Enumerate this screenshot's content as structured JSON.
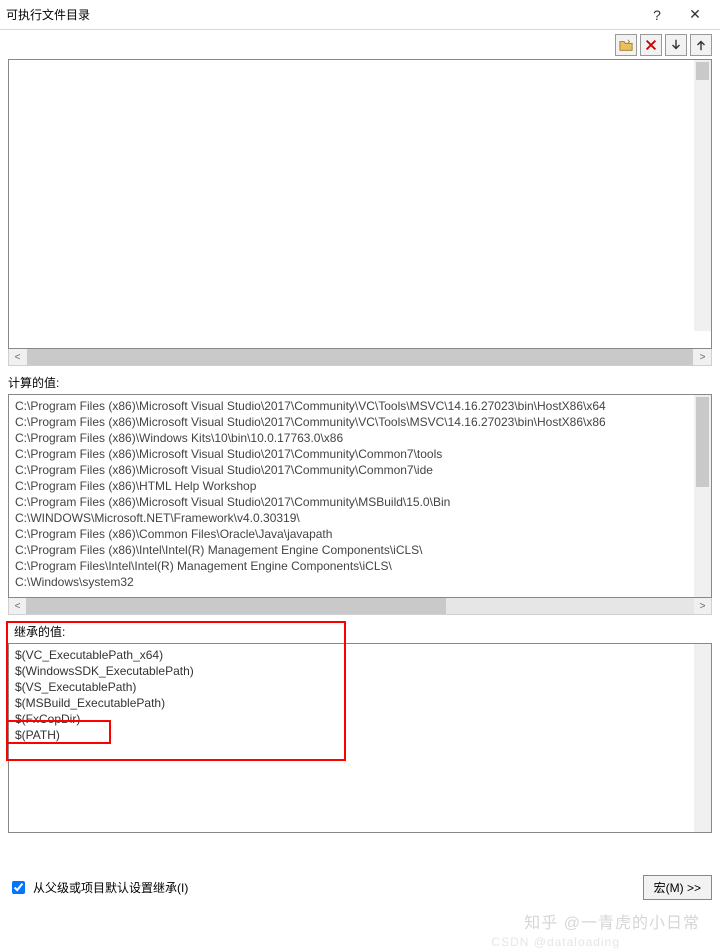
{
  "title": "可执行文件目录",
  "toolbar": {
    "new_folder_icon": "folder",
    "delete_icon": "x",
    "down_icon": "down",
    "up_icon": "up"
  },
  "computed": {
    "label": "计算的值:",
    "lines": [
      "C:\\Program Files (x86)\\Microsoft Visual Studio\\2017\\Community\\VC\\Tools\\MSVC\\14.16.27023\\bin\\HostX86\\x64",
      "C:\\Program Files (x86)\\Microsoft Visual Studio\\2017\\Community\\VC\\Tools\\MSVC\\14.16.27023\\bin\\HostX86\\x86",
      "C:\\Program Files (x86)\\Windows Kits\\10\\bin\\10.0.17763.0\\x86",
      "C:\\Program Files (x86)\\Microsoft Visual Studio\\2017\\Community\\Common7\\tools",
      "C:\\Program Files (x86)\\Microsoft Visual Studio\\2017\\Community\\Common7\\ide",
      "C:\\Program Files (x86)\\HTML Help Workshop",
      "C:\\Program Files (x86)\\Microsoft Visual Studio\\2017\\Community\\MSBuild\\15.0\\Bin",
      "C:\\WINDOWS\\Microsoft.NET\\Framework\\v4.0.30319\\",
      "C:\\Program Files (x86)\\Common Files\\Oracle\\Java\\javapath",
      "C:\\Program Files (x86)\\Intel\\Intel(R) Management Engine Components\\iCLS\\",
      "C:\\Program Files\\Intel\\Intel(R) Management Engine Components\\iCLS\\",
      "C:\\Windows\\system32"
    ]
  },
  "inherited": {
    "label": "继承的值:",
    "lines": [
      "$(VC_ExecutablePath_x64)",
      "$(WindowsSDK_ExecutablePath)",
      "$(VS_ExecutablePath)",
      "$(MSBuild_ExecutablePath)",
      "$(FxCopDir)",
      "$(PATH)"
    ]
  },
  "footer": {
    "checkbox_label": "从父级或项目默认设置继承(I)",
    "macro_button": "宏(M) >>"
  },
  "watermark": "知乎 @一青虎的小日常",
  "watermark2": "CSDN @dataloading"
}
